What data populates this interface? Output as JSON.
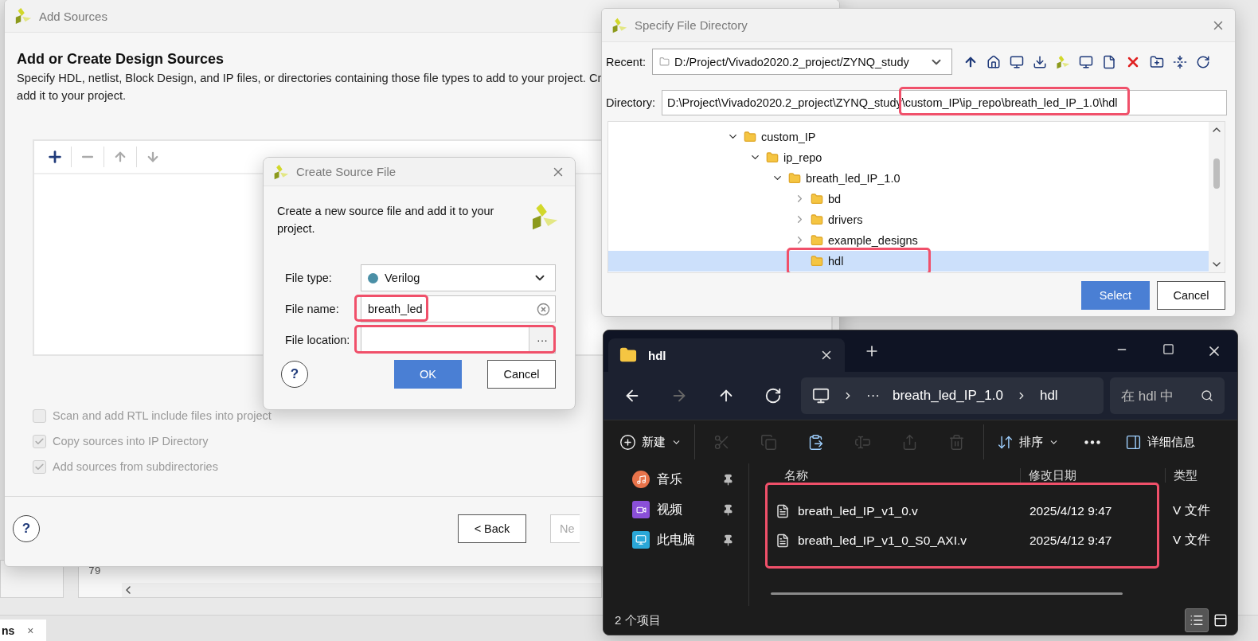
{
  "background": {
    "line_number": "79",
    "bottom_tab": {
      "label": "ns",
      "close": "×"
    }
  },
  "add_sources": {
    "title": "Add Sources",
    "heading": "Add or Create Design Sources",
    "description": [
      "Specify HDL, netlist, Block Design, and IP files, or directories containing those file types to add to your project. Cr",
      "add it to your project."
    ],
    "options": [
      {
        "label": "Scan and add RTL include files into project",
        "checked": false,
        "disabled": true
      },
      {
        "label": "Copy sources into IP Directory",
        "checked": true,
        "disabled": true
      },
      {
        "label": "Add sources from subdirectories",
        "checked": true,
        "disabled": true
      }
    ],
    "help": "?",
    "buttons": [
      {
        "label": "< Back",
        "disabled": false
      },
      {
        "label": "Ne",
        "disabled": true
      }
    ]
  },
  "create_source": {
    "title": "Create Source File",
    "intro": "Create a new source file and add it to your project.",
    "fields": [
      {
        "kind": "select",
        "label": "File type:",
        "value": "Verilog"
      },
      {
        "kind": "text",
        "label": "File name:",
        "value": "breath_led",
        "highlighted": true
      },
      {
        "kind": "browse",
        "label": "File location:",
        "button": "···",
        "highlighted": true
      }
    ],
    "help": "?",
    "buttons": [
      {
        "label": "OK",
        "primary": true
      },
      {
        "label": "Cancel",
        "primary": false
      }
    ]
  },
  "specify_directory": {
    "title": "Specify File Directory",
    "recent": {
      "label": "Recent:",
      "value": "D:/Project/Vivado2020.2_project/ZYNQ_study"
    },
    "directory": {
      "label": "Directory:",
      "value": "D:\\Project\\Vivado2020.2_project\\ZYNQ_study\\custom_IP\\ip_repo\\breath_led_IP_1.0\\hdl",
      "highlighted": true
    },
    "tree": [
      {
        "label": "custom_IP",
        "expanded": true,
        "selected": false,
        "children": [
          {
            "label": "ip_repo",
            "expanded": true,
            "selected": false,
            "children": [
              {
                "label": "breath_led_IP_1.0",
                "expanded": true,
                "selected": false,
                "children": [
                  {
                    "label": "bd",
                    "expanded": false,
                    "selected": false
                  },
                  {
                    "label": "drivers",
                    "expanded": false,
                    "selected": false
                  },
                  {
                    "label": "example_designs",
                    "expanded": false,
                    "selected": false
                  },
                  {
                    "label": "hdl",
                    "selected": true,
                    "highlighted": true
                  }
                ]
              }
            ]
          }
        ]
      }
    ],
    "buttons": [
      {
        "label": "Select",
        "primary": true
      },
      {
        "label": "Cancel",
        "primary": false
      }
    ]
  },
  "explorer": {
    "tab": {
      "title": "hdl"
    },
    "nav_buttons": [
      {
        "kind": "back",
        "disabled": false
      },
      {
        "kind": "forward",
        "disabled": true
      },
      {
        "kind": "up",
        "disabled": false
      },
      {
        "kind": "refresh",
        "disabled": false
      }
    ],
    "breadcrumb": [
      "···",
      "breath_led_IP_1.0",
      "hdl"
    ],
    "search": {
      "placeholder": "在 hdl 中"
    },
    "toolbar": [
      {
        "kind": "new",
        "label": "新建",
        "disabled": false
      },
      {
        "kind": "cut",
        "disabled": true
      },
      {
        "kind": "copy",
        "disabled": true
      },
      {
        "kind": "paste",
        "disabled": false
      },
      {
        "kind": "rename",
        "disabled": true
      },
      {
        "kind": "share",
        "disabled": true
      },
      {
        "kind": "delete",
        "disabled": true
      },
      {
        "kind": "sort",
        "label": "排序",
        "disabled": false
      },
      {
        "kind": "more",
        "disabled": false
      },
      {
        "kind": "details",
        "label": "详细信息",
        "disabled": false
      }
    ],
    "sidebar": [
      {
        "kind": "music",
        "label": "音乐"
      },
      {
        "kind": "video",
        "label": "视频"
      },
      {
        "kind": "computer",
        "label": "此电脑"
      }
    ],
    "columns": [
      "名称",
      "修改日期",
      "类型"
    ],
    "files": [
      {
        "name": "breath_led_IP_v1_0.v",
        "modified": "2025/4/12 9:47",
        "type": "V 文件"
      },
      {
        "name": "breath_led_IP_v1_0_S0_AXI.v",
        "modified": "2025/4/12 9:47",
        "type": "V 文件"
      }
    ],
    "files_highlighted": true,
    "status": "2 个项目",
    "views": [
      {
        "kind": "details",
        "selected": true
      },
      {
        "kind": "preview",
        "selected": false
      }
    ]
  }
}
